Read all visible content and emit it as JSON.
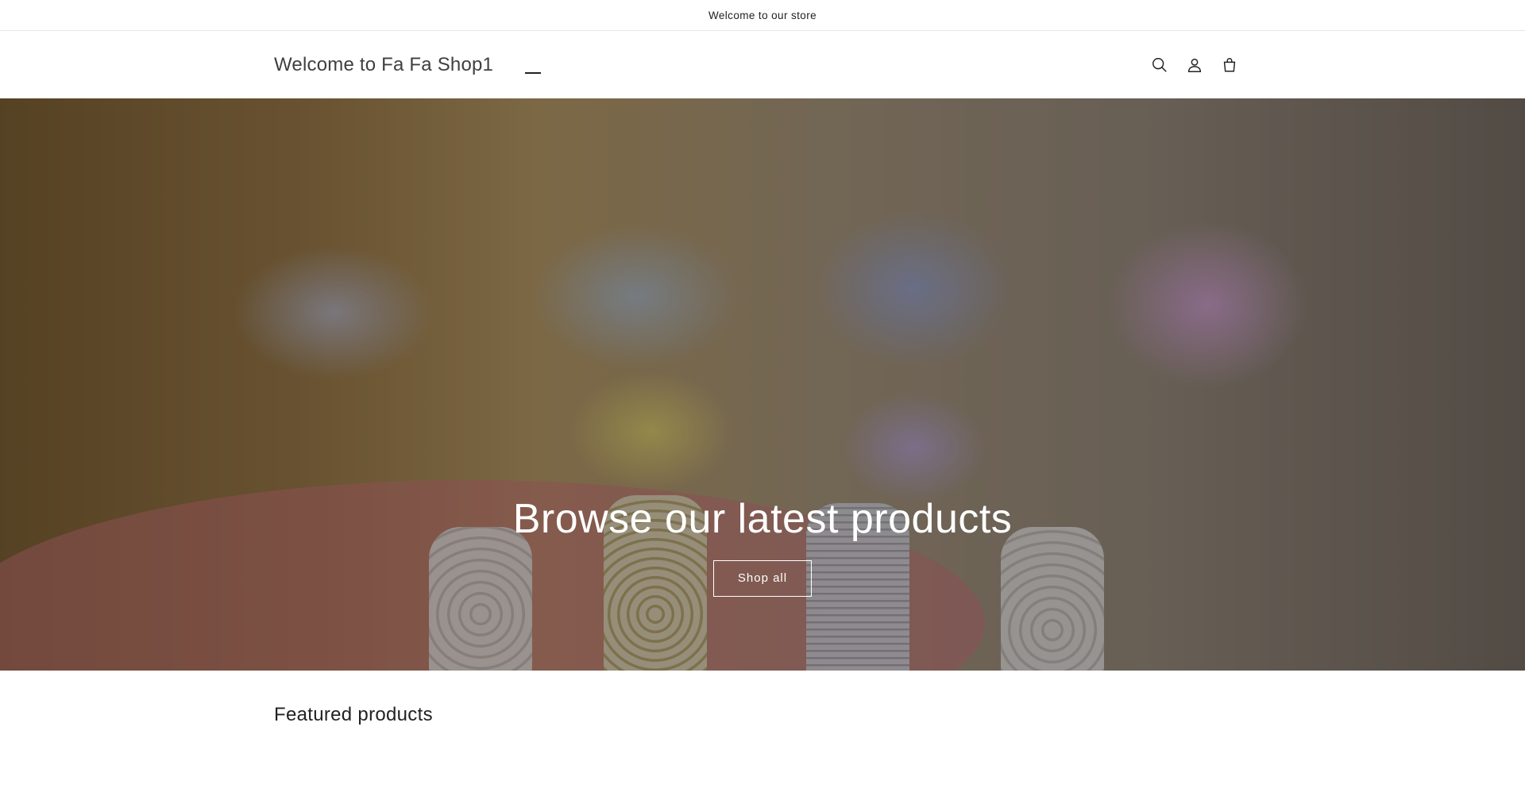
{
  "announcement": {
    "text": "Welcome to our store"
  },
  "header": {
    "brand": "Welcome to Fa Fa Shop1",
    "icons": [
      "menu-icon",
      "search-icon",
      "account-icon",
      "cart-icon"
    ]
  },
  "hero": {
    "title": "Browse our latest products",
    "button_label": "Shop all"
  },
  "featured": {
    "title": "Featured products"
  }
}
